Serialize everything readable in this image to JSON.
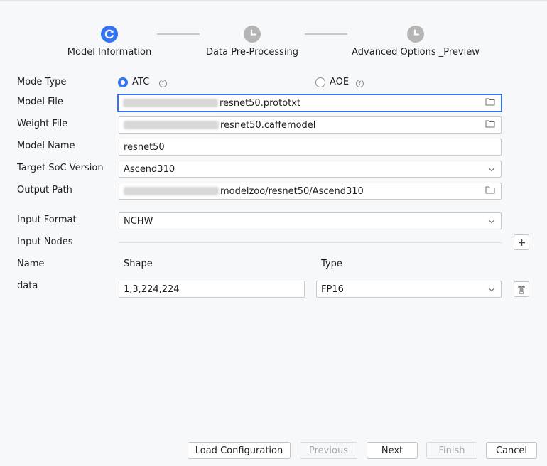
{
  "stepper": {
    "steps": [
      {
        "label": "Model Information",
        "state": "active"
      },
      {
        "label": "Data Pre-Processing",
        "state": "pending"
      },
      {
        "label": "Advanced Options _Preview",
        "state": "pending"
      }
    ]
  },
  "form": {
    "mode_type": {
      "label": "Mode Type",
      "options": [
        "ATC",
        "AOE"
      ],
      "selected": "ATC"
    },
    "model_file": {
      "label": "Model File",
      "value": "resnet50.prototxt"
    },
    "weight_file": {
      "label": "Weight File",
      "value": "resnet50.caffemodel"
    },
    "model_name": {
      "label": "Model Name",
      "value": "resnet50"
    },
    "target_soc": {
      "label": "Target SoC Version",
      "value": "Ascend310"
    },
    "output_path": {
      "label": "Output Path",
      "value": "modelzoo/resnet50/Ascend310"
    },
    "input_format": {
      "label": "Input Format",
      "value": "NCHW"
    },
    "input_nodes": {
      "label": "Input Nodes",
      "columns": {
        "name": "Name",
        "shape": "Shape",
        "type": "Type"
      },
      "rows": [
        {
          "name": "data",
          "shape": "1,3,224,224",
          "type": "FP16"
        }
      ]
    }
  },
  "buttons": {
    "load": "Load Configuration",
    "previous": "Previous",
    "next": "Next",
    "finish": "Finish",
    "cancel": "Cancel"
  },
  "colors": {
    "accent": "#3574f0",
    "pending": "#b5b5b5"
  }
}
